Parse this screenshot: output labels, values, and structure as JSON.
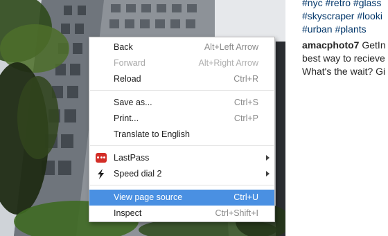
{
  "side_text": {
    "lines": [
      {
        "text": "#nyc #retro #glass"
      },
      {
        "text": "#skyscraper #looki"
      },
      {
        "text": "#urban #plants"
      }
    ],
    "comment_user": "amacphoto7",
    "comment_first": " GetIn",
    "comment_lines": [
      "best way to recieve",
      "What's the wait? Gi"
    ]
  },
  "menu": {
    "items": [
      {
        "label": "Back",
        "shortcut": "Alt+Left Arrow",
        "enabled": true
      },
      {
        "label": "Forward",
        "shortcut": "Alt+Right Arrow",
        "enabled": false
      },
      {
        "label": "Reload",
        "shortcut": "Ctrl+R",
        "enabled": true
      },
      {
        "label": "Save as...",
        "shortcut": "Ctrl+S",
        "enabled": true
      },
      {
        "label": "Print...",
        "shortcut": "Ctrl+P",
        "enabled": true
      },
      {
        "label": "Translate to English",
        "shortcut": "",
        "enabled": true
      },
      {
        "label": "LastPass",
        "shortcut": "",
        "enabled": true,
        "icon": "lastpass-icon",
        "submenu": true
      },
      {
        "label": "Speed dial 2",
        "shortcut": "",
        "enabled": true,
        "icon": "lightning-bolt-icon",
        "submenu": true
      },
      {
        "label": "View page source",
        "shortcut": "Ctrl+U",
        "enabled": true,
        "highlighted": true
      },
      {
        "label": "Inspect",
        "shortcut": "Ctrl+Shift+I",
        "enabled": true
      }
    ],
    "highlight_color": "#4a90e2"
  }
}
